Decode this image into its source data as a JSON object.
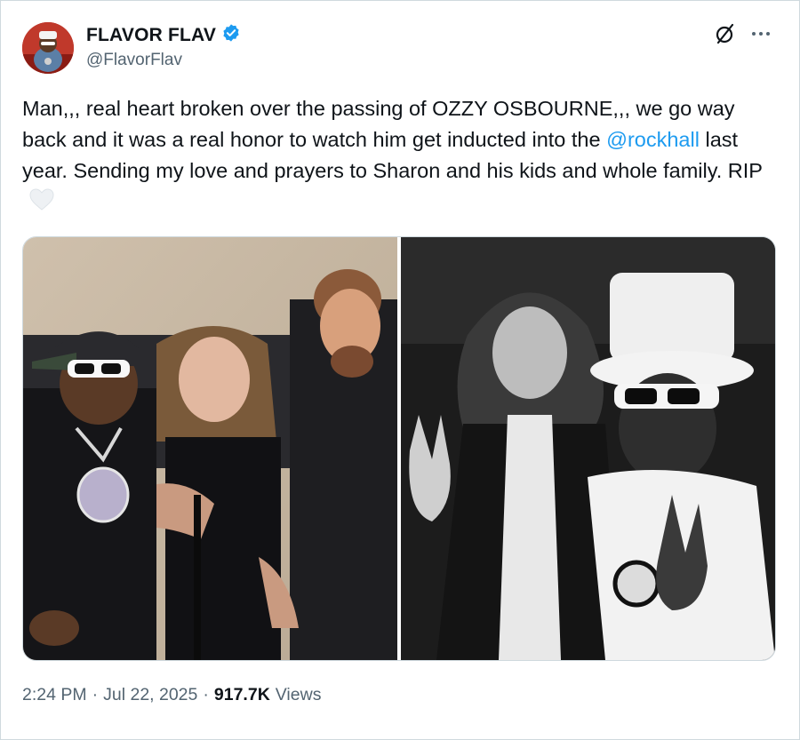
{
  "post": {
    "author": {
      "display_name": "FLAVOR FLAV",
      "handle": "@FlavorFlav",
      "verified": true,
      "verified_color": "#1d9bf0"
    },
    "text": {
      "line1": "Man,,, real heart broken over the passing of OZZY OSBOURNE,,, we go way back and it was a real honor to watch him get inducted into the ",
      "mention": "@rockhall",
      "line2": " last year. Sending my love and prayers to Sharon and his kids and whole family. RIP",
      "emoji": "white-heart"
    },
    "media": [
      {
        "kind": "color-photo",
        "icon": "photo"
      },
      {
        "kind": "black-and-white-photo",
        "icon": "photo"
      }
    ],
    "meta": {
      "time": "2:24 PM",
      "separator": "·",
      "date": "Jul 22, 2025",
      "views_count": "917.7K",
      "views_label": "Views"
    },
    "icons": {
      "grok": "grok-icon",
      "more": "more-icon"
    }
  }
}
